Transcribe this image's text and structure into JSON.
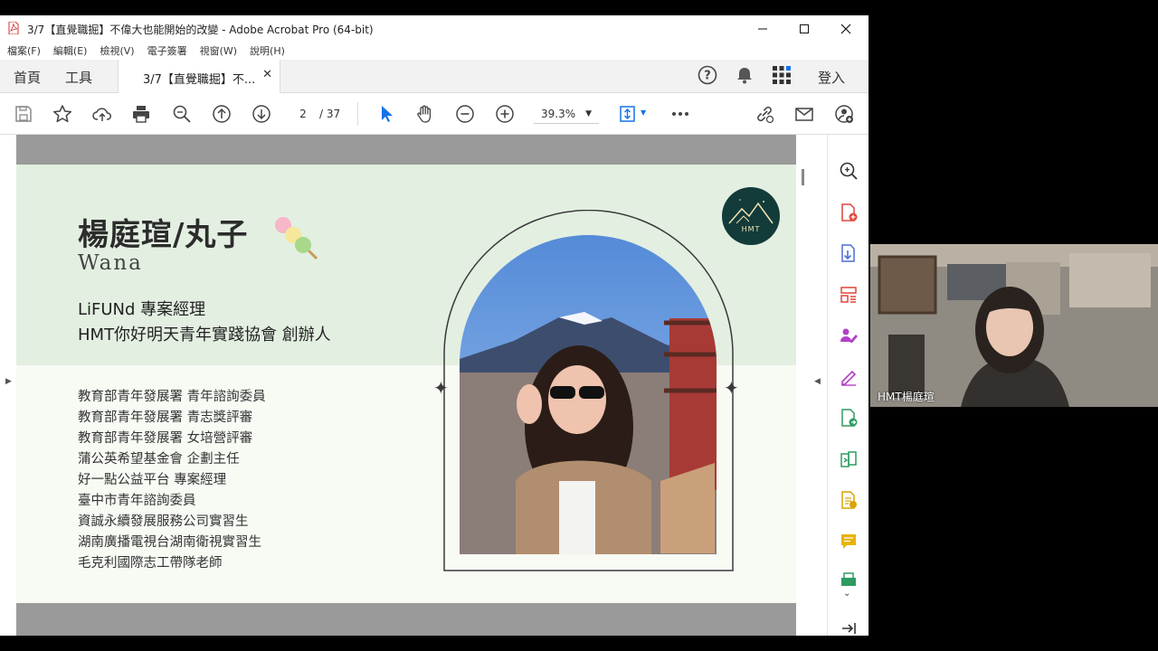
{
  "window": {
    "title": "3/7【直覺職掘】不偉大也能開始的改變 - Adobe Acrobat Pro (64-bit)"
  },
  "menu": [
    "檔案(F)",
    "編輯(E)",
    "檢視(V)",
    "電子簽署",
    "視窗(W)",
    "說明(H)"
  ],
  "tabs": {
    "home": "首頁",
    "tools": "工具",
    "document": "3/7【直覺職掘】不...",
    "signin": "登入"
  },
  "toolbar": {
    "page_current": "2",
    "page_total": "/ 37",
    "zoom": "39.3%"
  },
  "slide": {
    "name": "楊庭瑄/丸子",
    "english_name": "Wana",
    "roles": [
      "LiFUNd 專案經理",
      "HMT你好明天青年實踐協會 創辦人"
    ],
    "experience": [
      "教育部青年發展署 青年諮詢委員",
      "教育部青年發展署 青志獎評審",
      "教育部青年發展署 女培營評審",
      "蒲公英希望基金會 企劃主任",
      "好一點公益平台 專案經理",
      "臺中市青年諮詢委員",
      "資誠永續發展服務公司實習生",
      "湖南廣播電視台湖南衛視實習生",
      "毛克利國際志工帶隊老師"
    ],
    "badge_text": "HMT"
  },
  "video": {
    "participant_name": "HMT楊庭瑄"
  },
  "colors": {
    "accent_red": "#d32f2f",
    "acrobat_blue": "#1473e6",
    "slide_green": "#e3efe1"
  }
}
